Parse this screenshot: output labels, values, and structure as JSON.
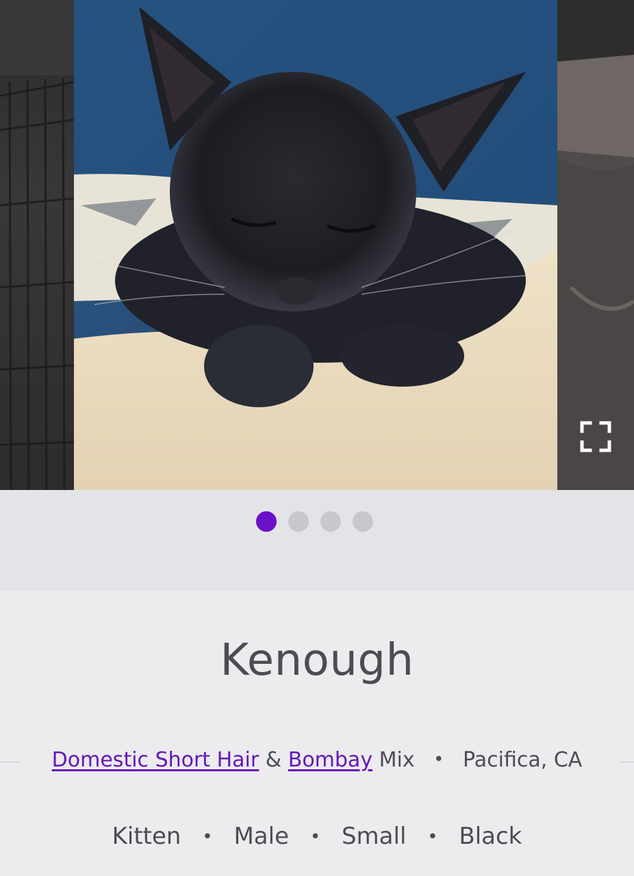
{
  "carousel": {
    "photo_subject": "black kitten sleeping on a lap",
    "expand_icon": "fullscreen-expand-icon",
    "total_photos": 4,
    "active_index": 0,
    "colors": {
      "active_dot": "#6b10c9",
      "inactive_dot": "#c8c7cc"
    }
  },
  "pet": {
    "name": "Kenough",
    "breeds": {
      "primary": "Domestic Short Hair",
      "connector": "&",
      "secondary": "Bombay",
      "suffix": "Mix"
    },
    "location": "Pacifica, CA",
    "attributes": [
      "Kitten",
      "Male",
      "Small",
      "Black"
    ],
    "separator": "•"
  },
  "colors": {
    "link": "#6418b8",
    "text": "#4d4c51",
    "background": "#ecebee"
  }
}
